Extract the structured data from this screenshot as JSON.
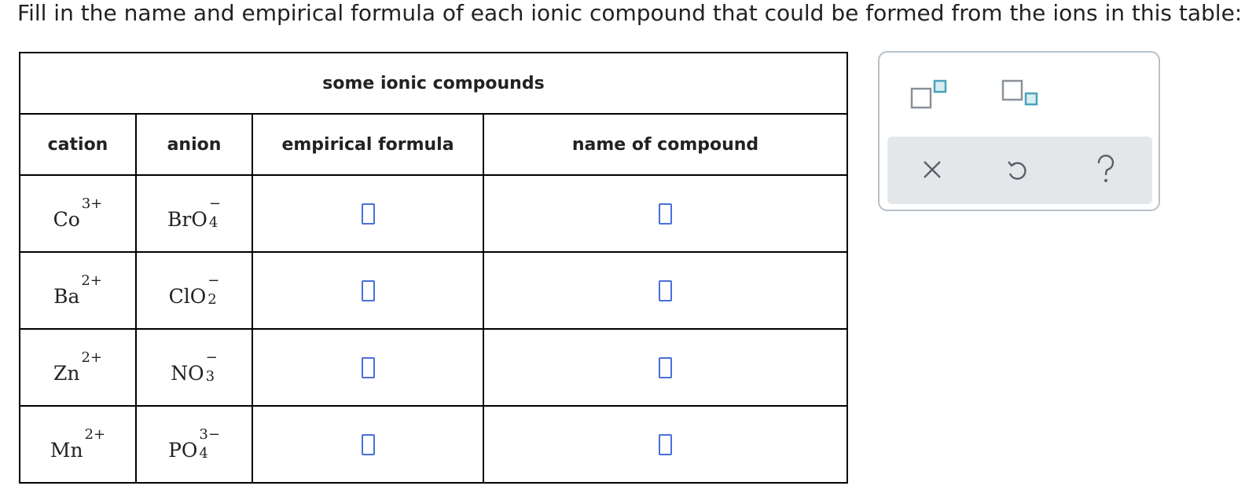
{
  "prompt": "Fill in the name and empirical formula of each ionic compound that could be formed from the ions in this table:",
  "table": {
    "caption": "some ionic compounds",
    "headers": [
      "cation",
      "anion",
      "empirical formula",
      "name of compound"
    ],
    "rows": [
      {
        "cation": {
          "symbol": "Co",
          "charge": "3+"
        },
        "anion": {
          "symbol": "BrO",
          "subscript": "4",
          "charge": "−"
        },
        "formula": "",
        "name": ""
      },
      {
        "cation": {
          "symbol": "Ba",
          "charge": "2+"
        },
        "anion": {
          "symbol": "ClO",
          "subscript": "2",
          "charge": "−"
        },
        "formula": "",
        "name": ""
      },
      {
        "cation": {
          "symbol": "Zn",
          "charge": "2+"
        },
        "anion": {
          "symbol": "NO",
          "subscript": "3",
          "charge": "−"
        },
        "formula": "",
        "name": ""
      },
      {
        "cation": {
          "symbol": "Mn",
          "charge": "2+"
        },
        "anion": {
          "symbol": "PO",
          "subscript": "4",
          "charge": "3−"
        },
        "formula": "",
        "name": ""
      }
    ]
  },
  "toolbar": {
    "icons": [
      "superscript-box-icon",
      "subscript-box-icon",
      "clear-x-icon",
      "undo-icon",
      "help-question-icon"
    ],
    "accent_color": "#4a6fdc",
    "tool_teal": "#4aa3b8",
    "tool_gray": "#8a9199"
  }
}
